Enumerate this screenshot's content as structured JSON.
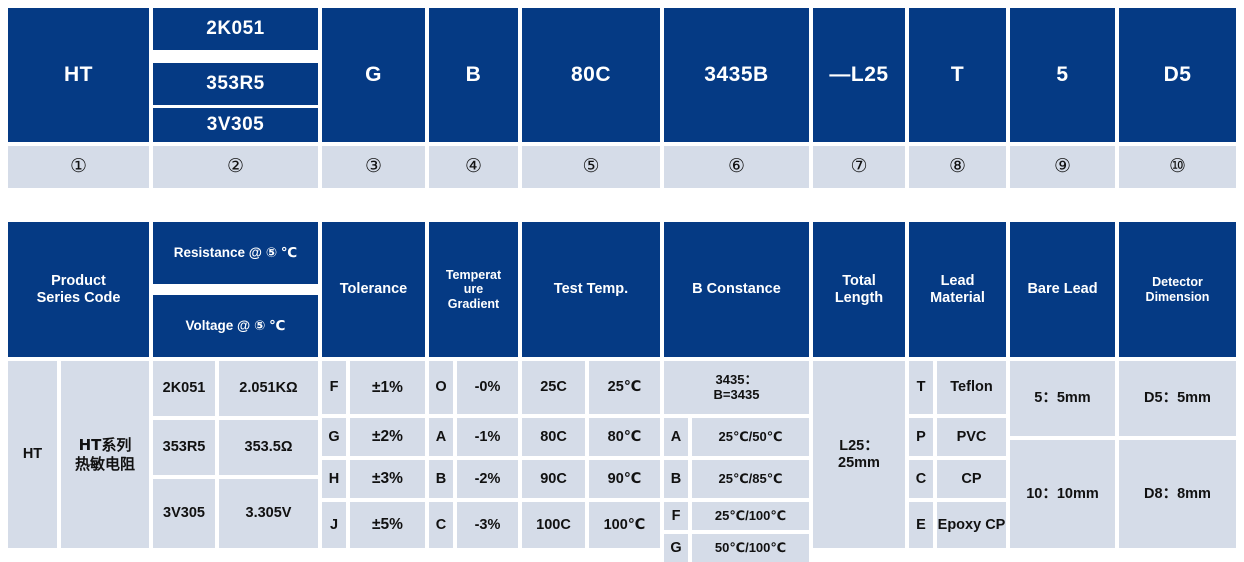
{
  "part_number_table": {
    "segments": [
      {
        "id": "seg1",
        "marker": "①",
        "codes": [
          "HT"
        ]
      },
      {
        "id": "seg2",
        "marker": "②",
        "codes": [
          "2K051",
          "353R5",
          "3V305"
        ]
      },
      {
        "id": "seg3",
        "marker": "③",
        "codes": [
          "G"
        ]
      },
      {
        "id": "seg4",
        "marker": "④",
        "codes": [
          "B"
        ]
      },
      {
        "id": "seg5",
        "marker": "⑤",
        "codes": [
          "80C"
        ]
      },
      {
        "id": "seg6",
        "marker": "⑥",
        "codes": [
          "3435B"
        ]
      },
      {
        "id": "seg7",
        "marker": "⑦",
        "codes": [
          "—L25"
        ]
      },
      {
        "id": "seg8",
        "marker": "⑧",
        "codes": [
          "T"
        ]
      },
      {
        "id": "seg9",
        "marker": "⑨",
        "codes": [
          "5"
        ]
      },
      {
        "id": "seg10",
        "marker": "⑩",
        "codes": [
          "D5"
        ]
      }
    ]
  },
  "legend_table": {
    "headers": {
      "product_series_code": "Product\nSeries Code",
      "resistance": "Resistance @ ⑤ ℃",
      "voltage": "Voltage @ ⑤ ℃",
      "tolerance": "Tolerance",
      "temperature_gradient": "Temperat\nure\nGradient",
      "test_temp": "Test Temp.",
      "b_constance": "B Constance",
      "total_length": "Total\nLength",
      "lead_material": "Lead\nMaterial",
      "bare_lead": "Bare Lead",
      "detector_dimension": "Detector\nDimension"
    },
    "product_series": {
      "code": "HT",
      "description": "HT系列\n热敏电阻"
    },
    "resistance_voltage": [
      {
        "code": "2K051",
        "value": "2.051KΩ"
      },
      {
        "code": "353R5",
        "value": "353.5Ω"
      },
      {
        "code": "3V305",
        "value": "3.305V"
      }
    ],
    "tolerance": [
      {
        "code": "F",
        "value": "±1%"
      },
      {
        "code": "G",
        "value": "±2%"
      },
      {
        "code": "H",
        "value": "±3%"
      },
      {
        "code": "J",
        "value": "±5%"
      }
    ],
    "temperature_gradient": [
      {
        "code": "O",
        "value": "-0%"
      },
      {
        "code": "A",
        "value": "-1%"
      },
      {
        "code": "B",
        "value": "-2%"
      },
      {
        "code": "C",
        "value": "-3%"
      }
    ],
    "test_temp": [
      {
        "code": "25C",
        "value": "25℃"
      },
      {
        "code": "80C",
        "value": "80℃"
      },
      {
        "code": "90C",
        "value": "90℃"
      },
      {
        "code": "100C",
        "value": "100℃"
      }
    ],
    "b_constance": {
      "note": "3435：\nB=3435",
      "rows": [
        {
          "code": "A",
          "value": "25℃/50℃"
        },
        {
          "code": "B",
          "value": "25℃/85℃"
        },
        {
          "code": "F",
          "value": "25℃/100℃"
        },
        {
          "code": "G",
          "value": "50℃/100℃"
        }
      ]
    },
    "total_length": "L25：\n25mm",
    "lead_material": [
      {
        "code": "T",
        "value": "Teflon"
      },
      {
        "code": "P",
        "value": "PVC"
      },
      {
        "code": "C",
        "value": "CP"
      },
      {
        "code": "E",
        "value": "Epoxy CP"
      }
    ],
    "bare_lead": [
      "5：5mm",
      "10：10mm"
    ],
    "detector_dimension": [
      "D5：5mm",
      "D8：8mm"
    ]
  },
  "colors": {
    "header_blue": "#053A84",
    "row_grey": "#D5DCE8",
    "page_background": "#FFFFFF",
    "header_text": "#FFFFFF",
    "body_text": "#111111"
  }
}
